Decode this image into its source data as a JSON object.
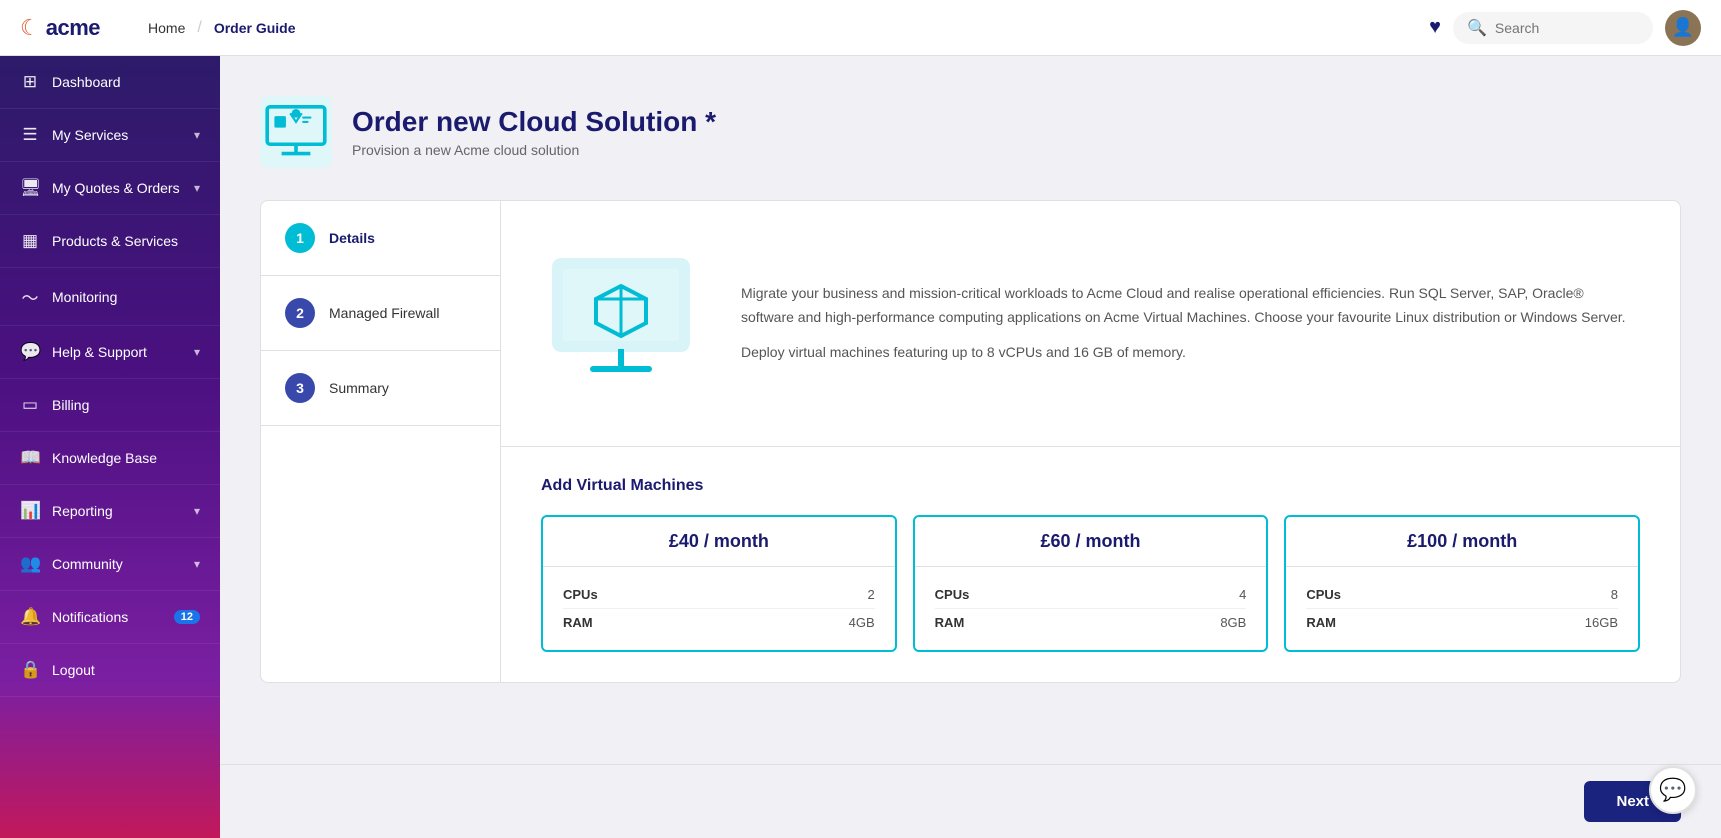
{
  "app": {
    "logo_icon": "☾",
    "logo_text": "acme"
  },
  "topnav": {
    "links": [
      {
        "label": "Home",
        "active": false
      },
      {
        "label": "Order Guide",
        "active": true
      }
    ],
    "search_placeholder": "Search",
    "heart_icon": "♥"
  },
  "sidebar": {
    "items": [
      {
        "id": "dashboard",
        "label": "Dashboard",
        "icon": "⊞",
        "has_arrow": false,
        "badge": null
      },
      {
        "id": "my-services",
        "label": "My Services",
        "icon": "☰",
        "has_arrow": true,
        "badge": null
      },
      {
        "id": "my-quotes",
        "label": "My Quotes & Orders",
        "icon": "🖥",
        "has_arrow": true,
        "badge": null
      },
      {
        "id": "products",
        "label": "Products & Services",
        "icon": "📦",
        "has_arrow": false,
        "badge": null
      },
      {
        "id": "monitoring",
        "label": "Monitoring",
        "icon": "📈",
        "has_arrow": false,
        "badge": null
      },
      {
        "id": "help",
        "label": "Help & Support",
        "icon": "💳",
        "has_arrow": true,
        "badge": null
      },
      {
        "id": "billing",
        "label": "Billing",
        "icon": "💳",
        "has_arrow": false,
        "badge": null
      },
      {
        "id": "knowledge",
        "label": "Knowledge Base",
        "icon": "📖",
        "has_arrow": false,
        "badge": null
      },
      {
        "id": "reporting",
        "label": "Reporting",
        "icon": "📊",
        "has_arrow": true,
        "badge": null
      },
      {
        "id": "community",
        "label": "Community",
        "icon": "👥",
        "has_arrow": true,
        "badge": null
      },
      {
        "id": "notifications",
        "label": "Notifications",
        "icon": "🔔",
        "has_arrow": false,
        "badge": "12"
      },
      {
        "id": "logout",
        "label": "Logout",
        "icon": "🔒",
        "has_arrow": false,
        "badge": null
      }
    ]
  },
  "page": {
    "title": "Order new Cloud Solution *",
    "subtitle": "Provision a new Acme cloud solution"
  },
  "wizard": {
    "steps": [
      {
        "num": "1",
        "label": "Details",
        "active": true
      },
      {
        "num": "2",
        "label": "Managed Firewall",
        "active": false
      },
      {
        "num": "3",
        "label": "Summary",
        "active": false
      }
    ]
  },
  "description": {
    "para1": "Migrate your business and mission-critical workloads to Acme Cloud and realise operational efficiencies. Run SQL Server, SAP, Oracle® software and high-performance computing applications on Acme Virtual Machines. Choose your favourite Linux distribution or Windows Server.",
    "para2": "Deploy virtual machines featuring up to 8 vCPUs and 16 GB of memory."
  },
  "vm_section": {
    "title": "Add Virtual Machines",
    "cards": [
      {
        "price": "£40 / month",
        "specs": [
          {
            "label": "CPUs",
            "value": "2"
          },
          {
            "label": "RAM",
            "value": "4GB"
          }
        ]
      },
      {
        "price": "£60 / month",
        "specs": [
          {
            "label": "CPUs",
            "value": "4"
          },
          {
            "label": "RAM",
            "value": "8GB"
          }
        ]
      },
      {
        "price": "£100 / month",
        "specs": [
          {
            "label": "CPUs",
            "value": "8"
          },
          {
            "label": "RAM",
            "value": "16GB"
          }
        ]
      }
    ]
  },
  "buttons": {
    "next": "Next"
  },
  "colors": {
    "primary": "#1a237e",
    "accent": "#00bcd4",
    "sidebar_gradient_top": "#2d1b69",
    "sidebar_gradient_bottom": "#c2185b"
  }
}
